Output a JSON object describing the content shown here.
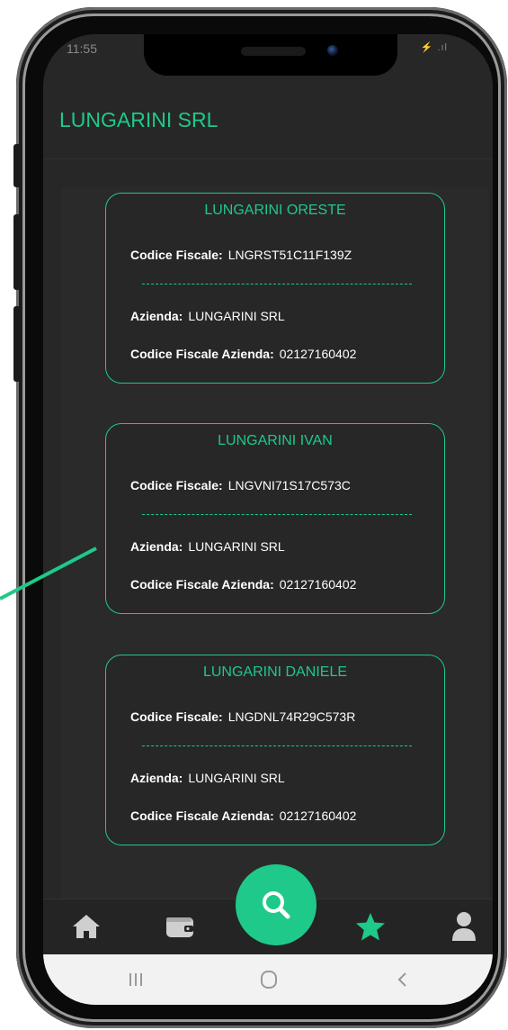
{
  "status": {
    "time": "11:55",
    "right": "⚡ .ıl"
  },
  "header": {
    "title": "LUNGARINI SRL"
  },
  "labels": {
    "codice_fiscale": "Codice Fiscale:",
    "azienda": "Azienda:",
    "codice_fiscale_azienda": "Codice Fiscale Azienda:"
  },
  "cards": [
    {
      "name": "LUNGARINI ORESTE",
      "codice_fiscale": "LNGRST51C11F139Z",
      "azienda": "LUNGARINI SRL",
      "codice_fiscale_azienda": "02127160402"
    },
    {
      "name": "LUNGARINI IVAN",
      "codice_fiscale": "LNGVNI71S17C573C",
      "azienda": "LUNGARINI SRL",
      "codice_fiscale_azienda": "02127160402"
    },
    {
      "name": "LUNGARINI DANIELE",
      "codice_fiscale": "LNGDNL74R29C573R",
      "azienda": "LUNGARINI SRL",
      "codice_fiscale_azienda": "02127160402"
    }
  ],
  "nav": {
    "items": [
      {
        "icon": "home-icon"
      },
      {
        "icon": "wallet-icon"
      },
      {
        "icon": "search-icon",
        "active_fab": true
      },
      {
        "icon": "star-icon",
        "active": true
      },
      {
        "icon": "user-icon"
      }
    ]
  },
  "system_nav": {
    "items": [
      "recent-apps-icon",
      "home-circle-icon",
      "back-icon"
    ]
  },
  "colors": {
    "accent": "#1ec98a",
    "background": "#272727",
    "text": "#ffffff"
  }
}
